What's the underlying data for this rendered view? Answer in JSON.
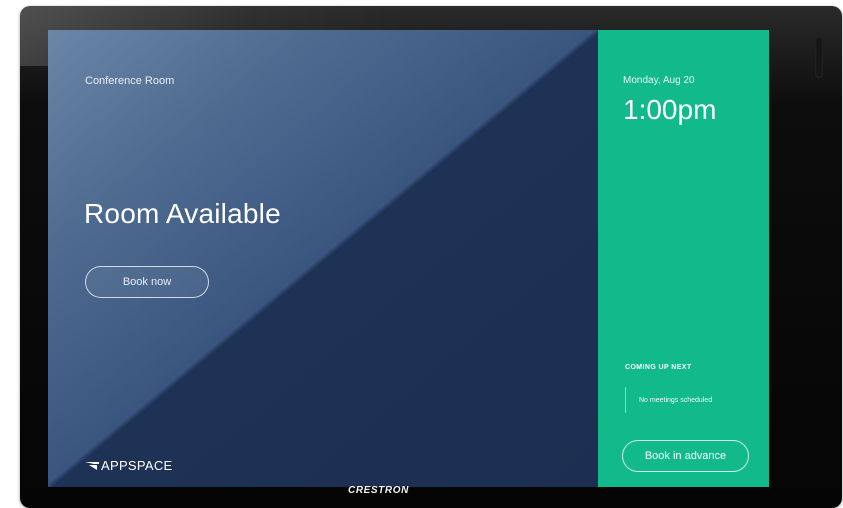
{
  "device": {
    "brand": "CRESTRON"
  },
  "main": {
    "room_name": "Conference Room",
    "status": "Room Available",
    "book_now_label": "Book now",
    "logo_text": "APPSPACE"
  },
  "side": {
    "date": "Monday, Aug 20",
    "time": "1:00pm",
    "coming_up_label": "COMING UP NEXT",
    "upcoming_text": "No meetings scheduled",
    "book_advance_label": "Book in advance"
  },
  "colors": {
    "available_green": "#12b98b",
    "main_blue_light": "#6a86a8",
    "main_blue_dark": "#1c2f52",
    "bezel": "#0d0d0d"
  },
  "icons": {
    "logo_mark": "appspace-logo-icon"
  }
}
